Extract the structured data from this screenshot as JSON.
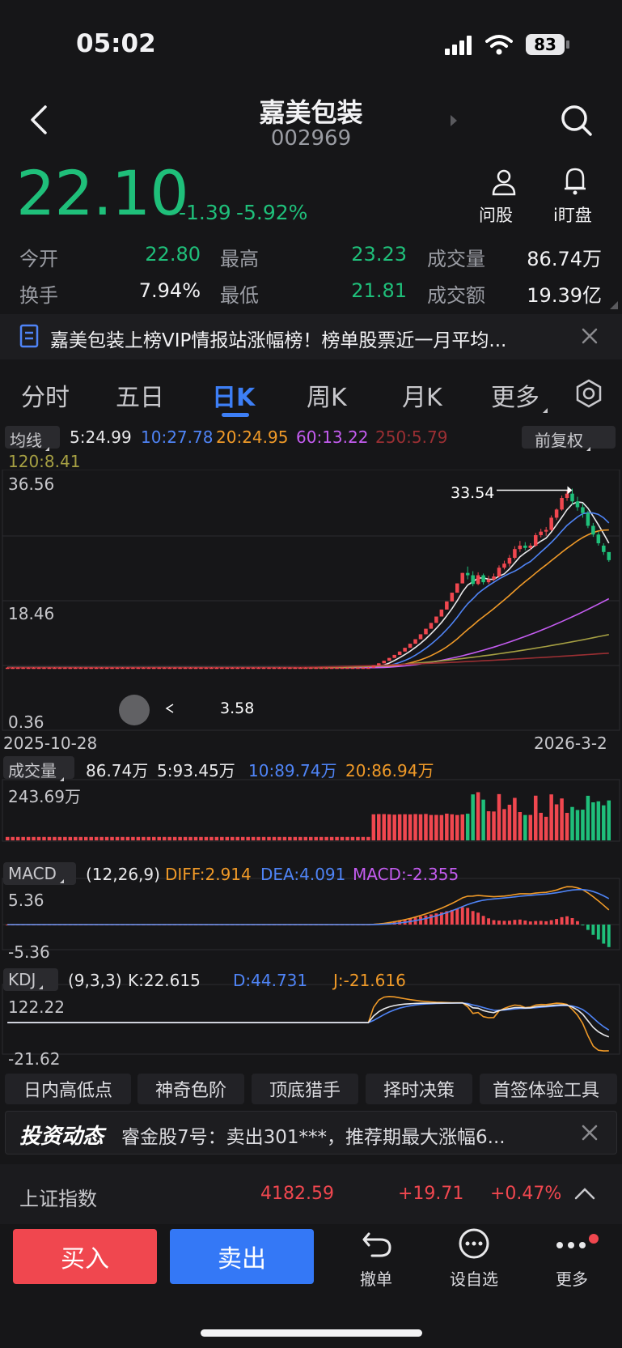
{
  "status_bar": {
    "time": "05:02",
    "battery": "83"
  },
  "header": {
    "name": "嘉美包装",
    "code": "002969"
  },
  "quote": {
    "price": "22.10",
    "change": "-1.39",
    "change_pct": "-5.92%",
    "stats": [
      {
        "label": "今开",
        "value": "22.80"
      },
      {
        "label": "最高",
        "value": "23.23"
      },
      {
        "label": "成交量",
        "value": "86.74万"
      },
      {
        "label": "换手",
        "value": "7.94%"
      },
      {
        "label": "最低",
        "value": "21.81"
      },
      {
        "label": "成交额",
        "value": "19.39亿"
      }
    ],
    "actions": {
      "ask": "问股",
      "watch": "i盯盘"
    }
  },
  "notice": {
    "text": "嘉美包装上榜VIP情报站涨幅榜！榜单股票近一月平均..."
  },
  "tabs": [
    "分时",
    "五日",
    "日K",
    "周K",
    "月K",
    "更多"
  ],
  "active_tab": "日K",
  "ma_bar": {
    "label": "均线",
    "adjust": "前复权",
    "ma5": "5:24.99",
    "ma10": "10:27.78",
    "ma20": "20:24.95",
    "ma60": "60:13.22",
    "ma250": "250:5.79",
    "ma120": "120:8.41"
  },
  "chart_data": {
    "type": "candlestick",
    "y_max_label": "36.56",
    "y_mid_label": "18.46",
    "y_min_label": "0.36",
    "x_start": "2025-10-28",
    "x_end": "2026-3-2",
    "high_marker": "33.54",
    "low_marker": "3.58",
    "candles": [
      [
        3.6,
        3.6,
        3.5,
        3.7
      ],
      [
        3.6,
        3.6,
        3.5,
        3.7
      ],
      [
        3.6,
        3.6,
        3.5,
        3.7
      ],
      [
        3.6,
        3.6,
        3.5,
        3.7
      ],
      [
        3.6,
        3.6,
        3.5,
        3.7
      ],
      [
        3.6,
        3.6,
        3.5,
        3.7
      ],
      [
        3.6,
        3.6,
        3.5,
        3.7
      ],
      [
        3.6,
        3.6,
        3.5,
        3.7
      ],
      [
        3.6,
        3.6,
        3.5,
        3.7
      ],
      [
        3.6,
        3.6,
        3.5,
        3.7
      ],
      [
        3.6,
        3.6,
        3.5,
        3.7
      ],
      [
        3.6,
        3.6,
        3.5,
        3.7
      ],
      [
        3.6,
        3.6,
        3.5,
        3.7
      ],
      [
        3.6,
        3.6,
        3.5,
        3.7
      ],
      [
        3.6,
        3.6,
        3.5,
        3.7
      ],
      [
        3.6,
        3.6,
        3.5,
        3.7
      ],
      [
        3.6,
        3.6,
        3.5,
        3.7
      ],
      [
        3.6,
        3.6,
        3.5,
        3.7
      ],
      [
        3.6,
        3.6,
        3.5,
        3.7
      ],
      [
        3.6,
        3.6,
        3.5,
        3.7
      ],
      [
        3.6,
        3.6,
        3.5,
        3.7
      ],
      [
        3.6,
        3.6,
        3.5,
        3.7
      ],
      [
        3.6,
        3.6,
        3.5,
        3.7
      ],
      [
        3.6,
        3.6,
        3.5,
        3.7
      ],
      [
        3.6,
        3.6,
        3.5,
        3.7
      ],
      [
        3.6,
        3.6,
        3.5,
        3.7
      ],
      [
        3.6,
        3.6,
        3.5,
        3.7
      ],
      [
        3.6,
        3.6,
        3.5,
        3.7
      ],
      [
        3.6,
        3.6,
        3.5,
        3.7
      ],
      [
        3.6,
        3.6,
        3.5,
        3.7
      ],
      [
        3.6,
        3.6,
        3.5,
        3.7
      ],
      [
        3.6,
        3.6,
        3.5,
        3.7
      ],
      [
        3.6,
        3.6,
        3.5,
        3.7
      ],
      [
        3.6,
        3.6,
        3.5,
        3.7
      ],
      [
        3.6,
        3.6,
        3.5,
        3.7
      ],
      [
        3.6,
        3.6,
        3.5,
        3.7
      ],
      [
        3.6,
        3.6,
        3.5,
        3.7
      ],
      [
        3.6,
        3.6,
        3.5,
        3.7
      ],
      [
        3.6,
        3.6,
        3.5,
        3.7
      ],
      [
        3.6,
        3.6,
        3.5,
        3.7
      ],
      [
        3.6,
        3.6,
        3.5,
        3.7
      ],
      [
        3.6,
        3.6,
        3.5,
        3.7
      ],
      [
        3.6,
        3.6,
        3.5,
        3.7
      ],
      [
        3.6,
        3.6,
        3.5,
        3.7
      ],
      [
        3.6,
        3.6,
        3.5,
        3.7
      ],
      [
        3.6,
        3.6,
        3.5,
        3.7
      ],
      [
        3.6,
        3.6,
        3.5,
        3.7
      ],
      [
        3.6,
        3.6,
        3.5,
        3.7
      ],
      [
        3.6,
        3.6,
        3.5,
        3.7
      ],
      [
        3.6,
        3.6,
        3.5,
        3.7
      ],
      [
        3.6,
        3.6,
        3.5,
        3.7
      ],
      [
        3.6,
        3.6,
        3.5,
        3.7
      ],
      [
        3.6,
        3.6,
        3.5,
        3.7
      ],
      [
        3.6,
        3.6,
        3.5,
        3.7
      ],
      [
        3.6,
        3.6,
        3.5,
        3.7
      ],
      [
        3.6,
        3.6,
        3.5,
        3.7
      ],
      [
        3.6,
        3.6,
        3.5,
        3.7
      ],
      [
        3.6,
        3.6,
        3.5,
        3.7
      ],
      [
        3.6,
        3.6,
        3.5,
        3.7
      ],
      [
        3.6,
        3.6,
        3.5,
        3.7
      ],
      [
        3.6,
        3.6,
        3.5,
        3.7
      ],
      [
        3.6,
        3.6,
        3.5,
        3.7
      ],
      [
        3.6,
        3.6,
        3.5,
        3.7
      ],
      [
        3.6,
        3.6,
        3.5,
        3.7
      ],
      [
        3.6,
        3.6,
        3.5,
        3.7
      ],
      [
        3.6,
        3.6,
        3.5,
        3.7
      ],
      [
        3.6,
        3.6,
        3.5,
        3.7
      ],
      [
        3.6,
        3.6,
        3.5,
        3.7
      ],
      [
        3.6,
        3.6,
        3.5,
        3.7
      ],
      [
        3.6,
        3.6,
        3.5,
        3.7
      ],
      [
        3.6,
        3.96,
        3.6,
        3.96
      ],
      [
        3.96,
        4.36,
        3.96,
        4.36
      ],
      [
        4.36,
        4.8,
        4.36,
        4.8
      ],
      [
        4.8,
        5.28,
        4.8,
        5.28
      ],
      [
        5.28,
        5.8,
        5.28,
        5.8
      ],
      [
        5.8,
        6.38,
        5.8,
        6.38
      ],
      [
        6.38,
        7.02,
        6.38,
        7.02
      ],
      [
        7.02,
        7.72,
        7.02,
        7.72
      ],
      [
        7.72,
        8.5,
        7.72,
        8.5
      ],
      [
        8.5,
        9.35,
        8.5,
        9.35
      ],
      [
        9.35,
        10.3,
        9.35,
        10.3
      ],
      [
        10.3,
        11.3,
        10.3,
        11.3
      ],
      [
        11.3,
        12.4,
        11.3,
        12.4
      ],
      [
        12.4,
        13.6,
        12.4,
        13.6
      ],
      [
        13.6,
        15.0,
        13.6,
        15.0
      ],
      [
        15.0,
        16.5,
        15.0,
        16.5
      ],
      [
        16.5,
        18.1,
        16.5,
        18.1
      ],
      [
        18.1,
        19.9,
        18.1,
        19.9
      ],
      [
        19.9,
        19.5,
        18.8,
        21.0
      ],
      [
        19.5,
        18.0,
        17.6,
        20.2
      ],
      [
        18.0,
        19.5,
        17.8,
        20.0
      ],
      [
        19.5,
        18.3,
        17.9,
        19.8
      ],
      [
        18.3,
        18.8,
        18.0,
        19.4
      ],
      [
        18.8,
        19.3,
        18.5,
        19.8
      ],
      [
        19.3,
        20.8,
        19.1,
        21.2
      ],
      [
        20.8,
        21.5,
        20.5,
        22.0
      ],
      [
        21.5,
        22.5,
        21.0,
        23.0
      ],
      [
        22.5,
        24.0,
        22.2,
        24.5
      ],
      [
        24.0,
        24.6,
        23.5,
        25.4
      ],
      [
        24.6,
        24.2,
        23.8,
        25.2
      ],
      [
        24.2,
        24.6,
        23.8,
        25.0
      ],
      [
        24.6,
        26.4,
        24.4,
        26.8
      ],
      [
        26.4,
        27.0,
        26.0,
        27.5
      ],
      [
        27.0,
        27.3,
        26.3,
        27.8
      ],
      [
        27.3,
        29.4,
        27.1,
        29.8
      ],
      [
        29.4,
        30.8,
        29.0,
        31.0
      ],
      [
        30.8,
        32.8,
        30.6,
        33.2
      ],
      [
        32.8,
        33.54,
        32.3,
        34.2
      ],
      [
        33.54,
        32.2,
        31.6,
        34.4
      ],
      [
        32.2,
        31.2,
        30.6,
        33.0
      ],
      [
        31.2,
        30.2,
        29.4,
        31.8
      ],
      [
        30.2,
        28.0,
        27.6,
        30.6
      ],
      [
        28.0,
        26.5,
        26.1,
        28.5
      ],
      [
        26.5,
        25.0,
        24.6,
        27.0
      ],
      [
        24.6,
        23.5,
        23.0,
        25.0
      ],
      [
        23.49,
        22.1,
        21.81,
        23.23
      ]
    ],
    "volume_labels": {
      "label": "成交量",
      "current": "86.74万",
      "ma5": "5:93.45万",
      "ma10": "10:89.74万",
      "ma20": "20:86.94万",
      "max": "243.69万"
    },
    "macd_labels": {
      "label": "MACD",
      "params": "(12,26,9)",
      "diff": "DIFF:2.914",
      "dea": "DEA:4.091",
      "macd": "MACD:-2.355",
      "max": "5.36",
      "min": "-5.36"
    },
    "kdj_labels": {
      "label": "KDJ",
      "params": "(9,3,3)",
      "k": "K:22.615",
      "d": "D:44.731",
      "j": "J:-21.616",
      "max": "122.22",
      "min": "-21.62"
    }
  },
  "features": [
    "日内高低点",
    "神奇色阶",
    "顶底猎手",
    "择时决策",
    "首签体验工具"
  ],
  "news": {
    "brand": "投资动态",
    "text": "睿金股7号：卖出301***，推荐期最大涨幅6..."
  },
  "index_bar": {
    "name": "上证指数",
    "value": "4182.59",
    "change": "+19.71",
    "pct": "+0.47%"
  },
  "bottom": {
    "buy": "买入",
    "sell": "卖出",
    "undo": "撤单",
    "watchlist": "设自选",
    "more": "更多"
  },
  "colors": {
    "up": "#f0474f",
    "down": "#1fbf7a",
    "blue": "#3478f6",
    "bg": "#161618"
  }
}
